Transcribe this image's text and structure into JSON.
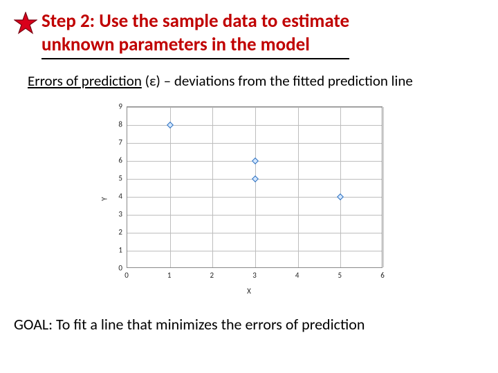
{
  "header": {
    "title_line1": "Step 2:  Use the sample data to estimate",
    "title_line2": "unknown parameters in the model"
  },
  "subhead": {
    "underlined": "Errors of prediction",
    "rest": " (ε) – deviations from the fitted prediction line"
  },
  "goal": "GOAL:  To fit a line that minimizes the errors of prediction",
  "chart_data": {
    "type": "scatter",
    "title": "",
    "xlabel": "X",
    "ylabel": "Y",
    "xlim": [
      0,
      6
    ],
    "ylim": [
      0,
      9
    ],
    "xticks": [
      0,
      1,
      2,
      3,
      4,
      5,
      6
    ],
    "yticks": [
      0,
      1,
      2,
      3,
      4,
      5,
      6,
      7,
      8,
      9
    ],
    "series": [
      {
        "name": "data",
        "x": [
          1,
          3,
          3,
          5
        ],
        "y": [
          8,
          6,
          5,
          4
        ]
      }
    ]
  }
}
